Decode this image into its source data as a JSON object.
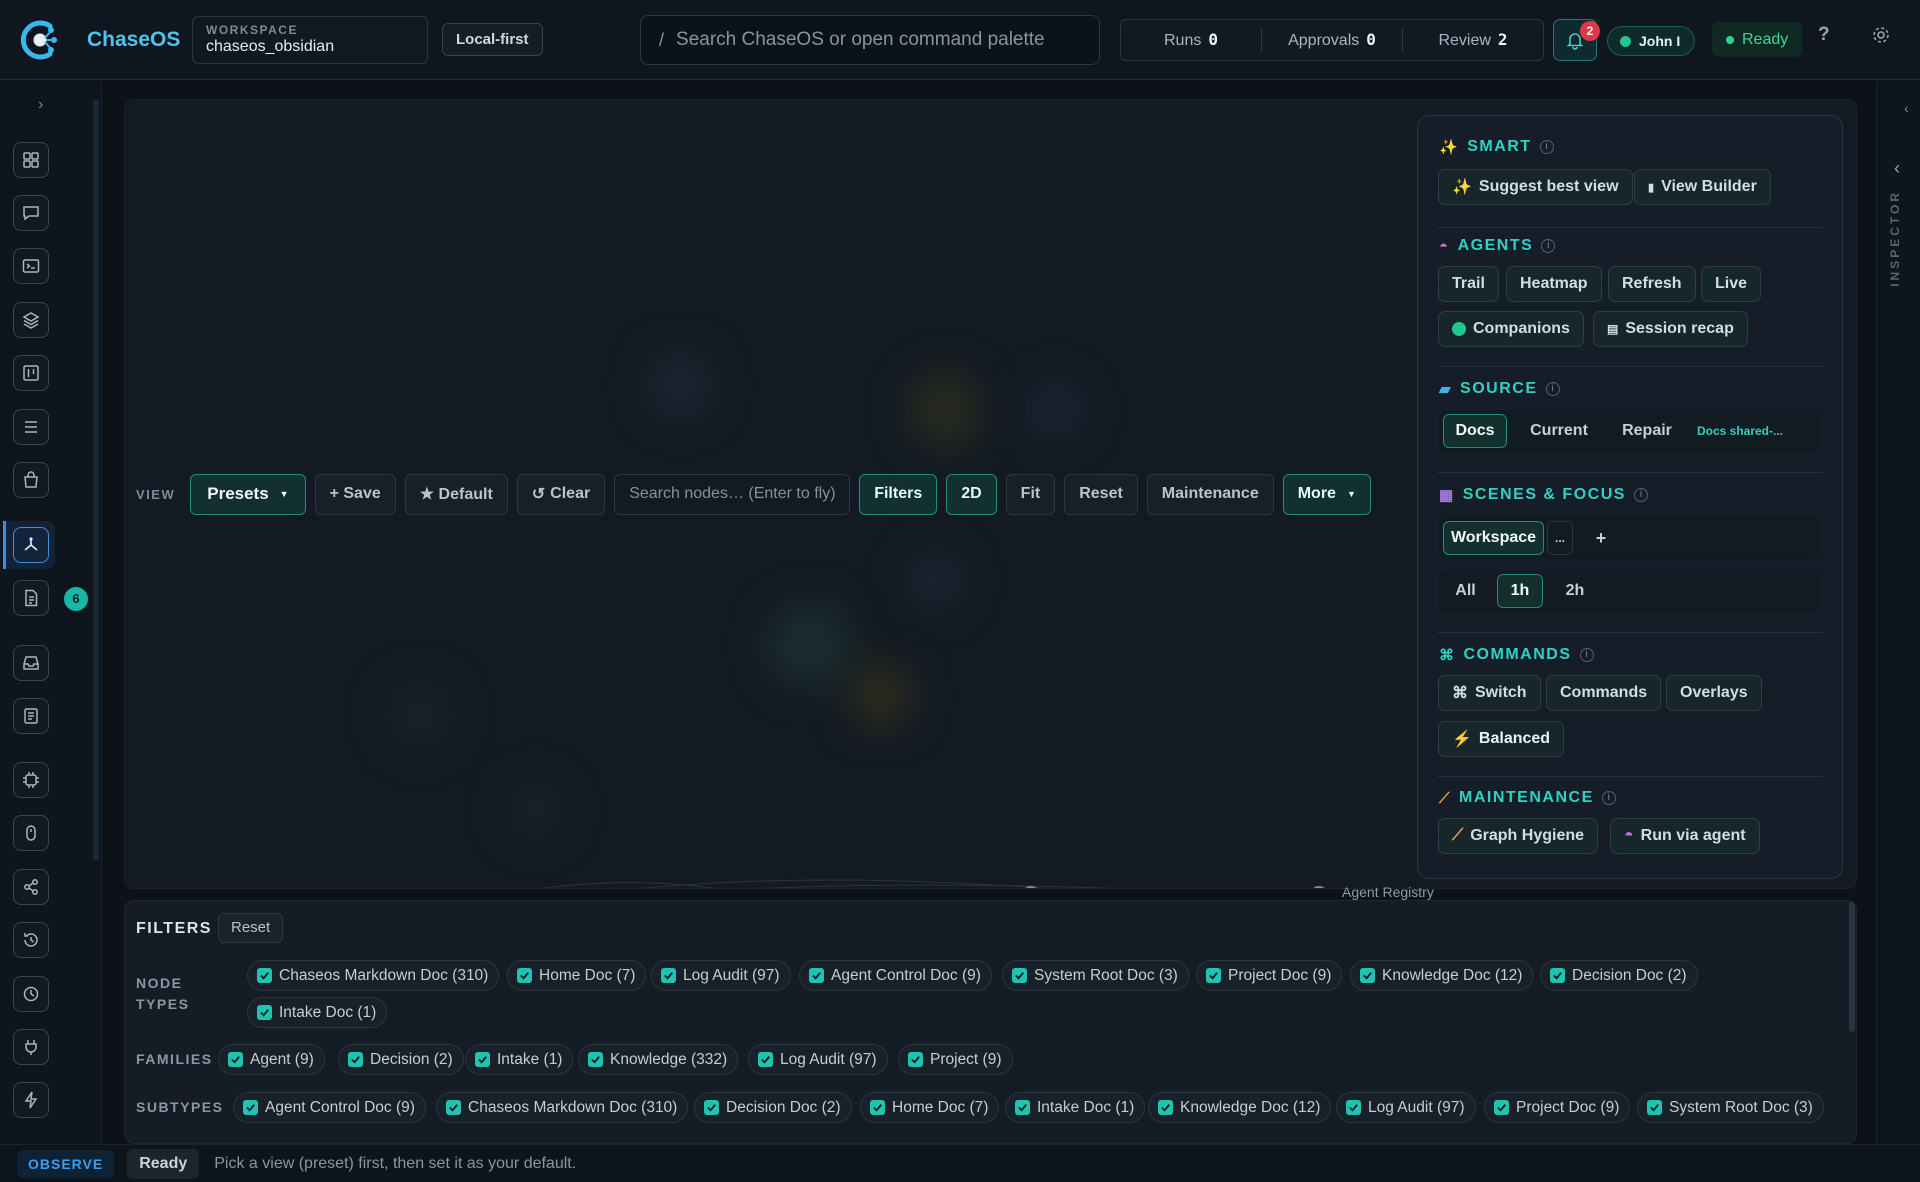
{
  "header": {
    "brand": "ChaseOS",
    "workspace_label": "WORKSPACE",
    "workspace_value": "chaseos_obsidian",
    "local_first": "Local-first",
    "search_slash": "/",
    "search_placeholder": "Search ChaseOS or open command palette",
    "stats": [
      {
        "label": "Runs",
        "value": "0"
      },
      {
        "label": "Approvals",
        "value": "0"
      },
      {
        "label": "Review",
        "value": "2"
      }
    ],
    "notifications_count": "2",
    "user": "John I",
    "status": "Ready",
    "help": "?"
  },
  "sidebar": {
    "icons": [
      "grid-icon",
      "chat-icon",
      "terminal-icon",
      "layers-icon",
      "board-icon",
      "list-icon",
      "bag-icon",
      "graph-icon",
      "document-icon",
      "inbox-icon",
      "notes-icon",
      "chip-icon",
      "mouse-icon",
      "share-icon",
      "history-icon",
      "clock-icon",
      "plug-icon",
      "bolt-icon"
    ],
    "active": "graph-icon",
    "badge": "6"
  },
  "toolbar": {
    "view_label": "VIEW",
    "presets": "Presets",
    "save": "+ Save",
    "default": "★ Default",
    "clear": "Clear",
    "search_placeholder": "Search nodes… (Enter to fly)",
    "filters": "Filters",
    "mode": "2D",
    "fit": "Fit",
    "reset": "Reset",
    "maintenance": "Maintenance",
    "more": "More"
  },
  "canvas": {
    "node_label": "Agent Registry"
  },
  "panel": {
    "smart": {
      "title": "SMART",
      "buttons": [
        "Suggest best view",
        "View Builder"
      ]
    },
    "agents": {
      "title": "AGENTS",
      "buttons": [
        "Trail",
        "Heatmap",
        "Refresh",
        "Live",
        "Companions",
        "Session recap"
      ]
    },
    "source": {
      "title": "SOURCE",
      "tabs": [
        "Docs",
        "Current",
        "Repair"
      ],
      "active": "Docs",
      "note": "Docs shared-..."
    },
    "scenes": {
      "title": "SCENES & FOCUS",
      "scene": "Workspace",
      "more": "...",
      "add": "+",
      "ranges": [
        "All",
        "1h",
        "2h"
      ],
      "active_range": "1h"
    },
    "commands": {
      "title": "COMMANDS",
      "buttons": [
        "Switch",
        "Commands",
        "Overlays",
        "Balanced"
      ]
    },
    "maintenance": {
      "title": "MAINTENANCE",
      "buttons": [
        "Graph Hygiene",
        "Run via agent"
      ]
    }
  },
  "inspector": {
    "label": "INSPECTOR"
  },
  "filters": {
    "title": "FILTERS",
    "reset": "Reset",
    "node_types_label": "NODE TYPES",
    "node_types": [
      "Chaseos Markdown Doc (310)",
      "Home Doc (7)",
      "Log Audit (97)",
      "Agent Control Doc (9)",
      "System Root Doc (3)",
      "Project Doc (9)",
      "Knowledge Doc (12)",
      "Decision Doc (2)",
      "Intake Doc (1)"
    ],
    "families_label": "FAMILIES",
    "families": [
      "Agent (9)",
      "Decision (2)",
      "Intake (1)",
      "Knowledge (332)",
      "Log Audit (97)",
      "Project (9)"
    ],
    "subtypes_label": "SUBTYPES",
    "subtypes": [
      "Agent Control Doc (9)",
      "Chaseos Markdown Doc (310)",
      "Decision Doc (2)",
      "Home Doc (7)",
      "Intake Doc (1)",
      "Knowledge Doc (12)",
      "Log Audit (97)",
      "Project Doc (9)",
      "System Root Doc (3)"
    ]
  },
  "statusbar": {
    "mode": "OBSERVE",
    "state": "Ready",
    "message": "Pick a view (preset) first, then set it as your default."
  },
  "colors": {
    "accent": "#2ed3c1",
    "brand": "#4fc3ee",
    "ready": "#3fd59a",
    "badge": "#e2364a"
  }
}
